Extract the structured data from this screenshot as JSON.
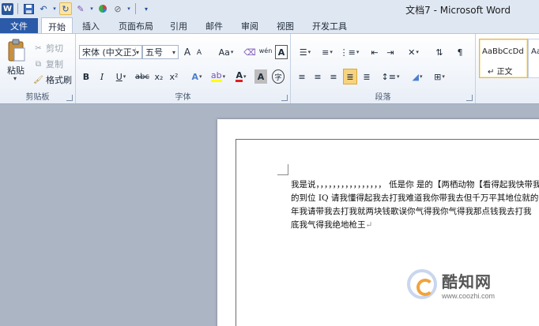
{
  "window": {
    "title": "文档7 - Microsoft Word",
    "logo": "W"
  },
  "quick_access": {
    "items": [
      "save-icon",
      "undo-icon",
      "redo-icon",
      "brush-icon",
      "color-icon",
      "format-icon",
      "customize-icon"
    ]
  },
  "tabs": [
    {
      "label": "文件",
      "active": false
    },
    {
      "label": "开始",
      "active": true
    },
    {
      "label": "插入",
      "active": false
    },
    {
      "label": "页面布局",
      "active": false
    },
    {
      "label": "引用",
      "active": false
    },
    {
      "label": "邮件",
      "active": false
    },
    {
      "label": "审阅",
      "active": false
    },
    {
      "label": "视图",
      "active": false
    },
    {
      "label": "开发工具",
      "active": false
    }
  ],
  "clipboard": {
    "paste": "粘贴",
    "cut": "剪切",
    "copy": "复制",
    "format_painter": "格式刷",
    "group_label": "剪贴板"
  },
  "font": {
    "font_name": "宋体 (中文正文)",
    "font_size": "五号",
    "grow": "A",
    "shrink": "A",
    "case": "Aa",
    "phonetic": "wén",
    "bold": "B",
    "italic": "I",
    "underline": "U",
    "strike": "abc",
    "subscript": "x₂",
    "superscript": "x²",
    "font_color": "A",
    "char_shading": "A",
    "enclose": "字",
    "group_label": "字体"
  },
  "paragraph": {
    "group_label": "段落"
  },
  "styles": {
    "sample": "AaBbCcDd",
    "normal": "正文",
    "sample2": "Aa"
  },
  "document": {
    "lines": [
      "我是说，，，，，，，，，，，，，，，， 低是你  是的【两栖动物【看得起我快带我",
      "的到位 IQ 请我懂得起我去打我难道我你带我去但千万平其地位就的",
      "年我请带我去打我就两块钱歌误你气得我你气得我那点钱我去打我",
      "底我气得我绝地枪王"
    ]
  },
  "watermark": {
    "name": "酷知网",
    "url": "www.coozhi.com"
  },
  "colors": {
    "file_tab": "#2a5aa8",
    "highlight": "#ffff00",
    "font_color": "#e02020"
  }
}
